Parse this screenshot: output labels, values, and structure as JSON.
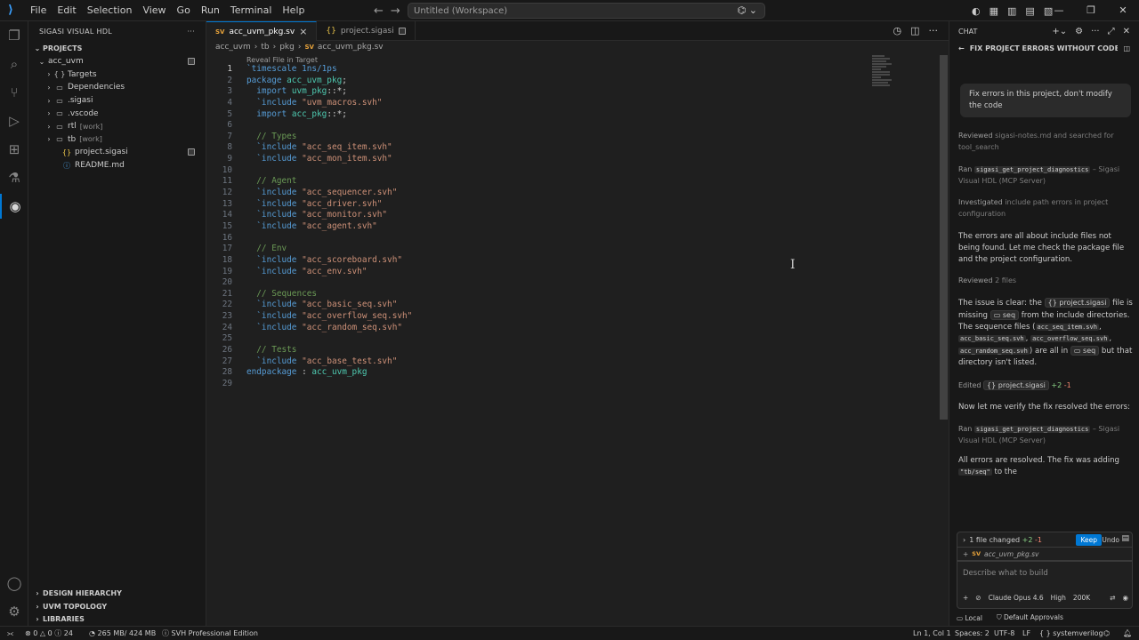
{
  "titlebar": {
    "menu": [
      "File",
      "Edit",
      "Selection",
      "View",
      "Go",
      "Run",
      "Terminal",
      "Help"
    ],
    "workspace": "Untitled (Workspace)"
  },
  "sidebar": {
    "title": "SIGASI VISUAL HDL",
    "section": "PROJECTS",
    "tree": [
      {
        "label": "acc_uvm",
        "chev": "⌄",
        "icon": "",
        "work": "",
        "badge": true,
        "indent": 10
      },
      {
        "label": "Targets",
        "chev": "›",
        "icon": "{ }",
        "work": "",
        "badge": false,
        "indent": 18
      },
      {
        "label": "Dependencies",
        "chev": "›",
        "icon": "▭",
        "work": "",
        "badge": false,
        "indent": 18
      },
      {
        "label": ".sigasi",
        "chev": "›",
        "icon": "▭",
        "work": "",
        "badge": false,
        "indent": 18
      },
      {
        "label": ".vscode",
        "chev": "›",
        "icon": "▭",
        "work": "",
        "badge": false,
        "indent": 18
      },
      {
        "label": "rtl",
        "chev": "›",
        "icon": "▭",
        "work": "[work]",
        "badge": false,
        "indent": 18
      },
      {
        "label": "tb",
        "chev": "›",
        "icon": "▭",
        "work": "[work]",
        "badge": false,
        "indent": 18
      },
      {
        "label": "project.sigasi",
        "chev": "",
        "icon": "{}",
        "work": "",
        "badge": true,
        "indent": 26
      },
      {
        "label": "README.md",
        "chev": "",
        "icon": "ⓘ",
        "work": "",
        "badge": false,
        "indent": 26
      }
    ],
    "bottom": [
      "DESIGN HIERARCHY",
      "UVM TOPOLOGY",
      "LIBRARIES"
    ]
  },
  "editor": {
    "tabs": [
      {
        "label": "acc_uvm_pkg.sv",
        "type": "SV"
      },
      {
        "label": "project.sigasi",
        "type": "{}"
      }
    ],
    "breadcrumb": [
      "acc_uvm",
      "tb",
      "pkg",
      "acc_uvm_pkg.sv"
    ],
    "breadcrumb_badge": "SV",
    "reveal": "Reveal File in Target",
    "lines": [
      [
        {
          "t": "`timescale 1ns/1ps",
          "c": "kw"
        }
      ],
      [
        {
          "t": "package ",
          "c": "kw"
        },
        {
          "t": "acc_uvm_pkg",
          "c": "id"
        },
        {
          "t": ";",
          "c": ""
        }
      ],
      [
        {
          "t": "  import ",
          "c": "kw"
        },
        {
          "t": "uvm_pkg",
          "c": "id"
        },
        {
          "t": "::*;",
          "c": ""
        }
      ],
      [
        {
          "t": "  `include ",
          "c": "kw"
        },
        {
          "t": "\"uvm_macros.svh\"",
          "c": "str"
        }
      ],
      [
        {
          "t": "  import ",
          "c": "kw"
        },
        {
          "t": "acc_pkg",
          "c": "id"
        },
        {
          "t": "::*;",
          "c": ""
        }
      ],
      [],
      [
        {
          "t": "  // Types",
          "c": "cm"
        }
      ],
      [
        {
          "t": "  `include ",
          "c": "kw"
        },
        {
          "t": "\"acc_seq_item.svh\"",
          "c": "str"
        }
      ],
      [
        {
          "t": "  `include ",
          "c": "kw"
        },
        {
          "t": "\"acc_mon_item.svh\"",
          "c": "str"
        }
      ],
      [],
      [
        {
          "t": "  // Agent",
          "c": "cm"
        }
      ],
      [
        {
          "t": "  `include ",
          "c": "kw"
        },
        {
          "t": "\"acc_sequencer.svh\"",
          "c": "str"
        }
      ],
      [
        {
          "t": "  `include ",
          "c": "kw"
        },
        {
          "t": "\"acc_driver.svh\"",
          "c": "str"
        }
      ],
      [
        {
          "t": "  `include ",
          "c": "kw"
        },
        {
          "t": "\"acc_monitor.svh\"",
          "c": "str"
        }
      ],
      [
        {
          "t": "  `include ",
          "c": "kw"
        },
        {
          "t": "\"acc_agent.svh\"",
          "c": "str"
        }
      ],
      [],
      [
        {
          "t": "  // Env",
          "c": "cm"
        }
      ],
      [
        {
          "t": "  `include ",
          "c": "kw"
        },
        {
          "t": "\"acc_scoreboard.svh\"",
          "c": "str"
        }
      ],
      [
        {
          "t": "  `include ",
          "c": "kw"
        },
        {
          "t": "\"acc_env.svh\"",
          "c": "str"
        }
      ],
      [],
      [
        {
          "t": "  // Sequences",
          "c": "cm"
        }
      ],
      [
        {
          "t": "  `include ",
          "c": "kw"
        },
        {
          "t": "\"acc_basic_seq.svh\"",
          "c": "str"
        }
      ],
      [
        {
          "t": "  `include ",
          "c": "kw"
        },
        {
          "t": "\"acc_overflow_seq.svh\"",
          "c": "str"
        }
      ],
      [
        {
          "t": "  `include ",
          "c": "kw"
        },
        {
          "t": "\"acc_random_seq.svh\"",
          "c": "str"
        }
      ],
      [],
      [
        {
          "t": "  // Tests",
          "c": "cm"
        }
      ],
      [
        {
          "t": "  `include ",
          "c": "kw"
        },
        {
          "t": "\"acc_base_test.svh\"",
          "c": "str"
        }
      ],
      [
        {
          "t": "endpackage ",
          "c": "kw"
        },
        {
          "t": ": ",
          "c": ""
        },
        {
          "t": "acc_uvm_pkg",
          "c": "id"
        }
      ],
      []
    ]
  },
  "chat": {
    "header": "CHAT",
    "title": "FIX PROJECT ERRORS WITHOUT CODE CHA...",
    "user_message": "Fix errors in this project, don't modify the code",
    "reviewed_1": {
      "a": "Reviewed ",
      "b": "sigasi-notes.md and searched for tool_search"
    },
    "ran_1": {
      "a": "Ran ",
      "code": "sigasi_get_project_diagnostics",
      "b": " – Sigasi Visual HDL (MCP Server)"
    },
    "investigated": {
      "a": "Investigated ",
      "b": "include path errors in project configuration"
    },
    "msg_1": "The errors are all about include files not being found. Let me check the package file and the project configuration.",
    "reviewed_2": {
      "a": "Reviewed ",
      "b": "2 files"
    },
    "msg_2": {
      "p1": "The issue is clear: the ",
      "chip1": "{} project.sigasi",
      "p2": " file is missing ",
      "chip2": "▭ seq",
      "p3": " from the include directories. The sequence files (",
      "c1": "acc_seq_item.svh",
      "c2": "acc_basic_seq.svh",
      "c3": "acc_overflow_seq.svh",
      "c4": "acc_random_seq.svh",
      "p4": ") are all in ",
      "chip3": "▭ seq",
      "p5": " but that directory isn't listed."
    },
    "edited": {
      "a": "Edited ",
      "chip": "{} project.sigasi",
      "add": "+2",
      "rem": "-1"
    },
    "msg_3": "Now let me verify the fix resolved the errors:",
    "ran_2": {
      "a": "Ran ",
      "code": "sigasi_get_project_diagnostics",
      "b": " – Sigasi Visual HDL (MCP Server)"
    },
    "msg_4": {
      "p1": "All errors are resolved. The fix was adding ",
      "code": "\"tb/seq\"",
      "p2": " to the"
    },
    "changed": {
      "label": "1 file changed",
      "add": "+2",
      "rem": "-1",
      "keep": "Keep",
      "undo": "Undo"
    },
    "changed_file": "acc_uvm_pkg.sv",
    "changed_file_badge": "SV",
    "input_placeholder": "Describe what to build",
    "model": "Claude Opus 4.6",
    "effort": "High",
    "context": "200K",
    "footer_local": "Local",
    "footer_approvals": "Default Approvals"
  },
  "status": {
    "remote": "⪥",
    "problems": "⊗ 0 △ 0 ⓘ 24",
    "memory": "265 MB/ 424 MB",
    "edition": "SVH Professional Edition",
    "position": "Ln 1, Col 1",
    "spaces": "Spaces: 2",
    "encoding": "UTF-8",
    "eol": "LF",
    "language": "{ } systemverilog"
  }
}
